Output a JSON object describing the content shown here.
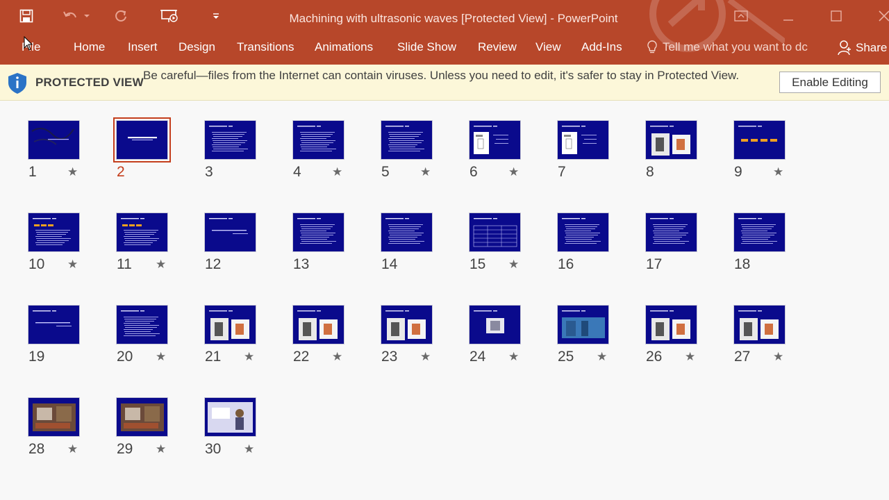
{
  "window": {
    "title": "Machining with ultrasonic waves [Protected View] - PowerPoint"
  },
  "qat": {
    "save_icon": "save-icon",
    "undo_icon": "undo-icon",
    "redo_icon": "redo-icon",
    "present_icon": "present-from-beginning-icon",
    "customize_icon": "customize-qat-icon"
  },
  "tabs": [
    {
      "label": "File"
    },
    {
      "label": "Home"
    },
    {
      "label": "Insert"
    },
    {
      "label": "Design"
    },
    {
      "label": "Transitions"
    },
    {
      "label": "Animations"
    },
    {
      "label": "Slide Show"
    },
    {
      "label": "Review"
    },
    {
      "label": "View"
    },
    {
      "label": "Add-Ins"
    }
  ],
  "tell_me": {
    "placeholder": "Tell me what you want to dc"
  },
  "share": {
    "label": "Share"
  },
  "protected_view": {
    "label": "PROTECTED VIEW",
    "message": "Be careful—files from the Internet can contain viruses. Unless you need to edit, it's safer to stay in Protected View.",
    "button": "Enable Editing"
  },
  "slides": [
    {
      "number": "1",
      "has_animation": true,
      "kind": "title-dark",
      "selected": false
    },
    {
      "number": "2",
      "has_animation": false,
      "kind": "title",
      "selected": true
    },
    {
      "number": "3",
      "has_animation": false,
      "kind": "text",
      "selected": false
    },
    {
      "number": "4",
      "has_animation": true,
      "kind": "text",
      "selected": false
    },
    {
      "number": "5",
      "has_animation": true,
      "kind": "text",
      "selected": false
    },
    {
      "number": "6",
      "has_animation": true,
      "kind": "diagram",
      "selected": false
    },
    {
      "number": "7",
      "has_animation": false,
      "kind": "diagram",
      "selected": false
    },
    {
      "number": "8",
      "has_animation": false,
      "kind": "photo",
      "selected": false
    },
    {
      "number": "9",
      "has_animation": true,
      "kind": "flow",
      "selected": false
    },
    {
      "number": "10",
      "has_animation": true,
      "kind": "flow-text",
      "selected": false
    },
    {
      "number": "11",
      "has_animation": true,
      "kind": "flow-text",
      "selected": false
    },
    {
      "number": "12",
      "has_animation": false,
      "kind": "sparse",
      "selected": false
    },
    {
      "number": "13",
      "has_animation": false,
      "kind": "text",
      "selected": false
    },
    {
      "number": "14",
      "has_animation": false,
      "kind": "text",
      "selected": false
    },
    {
      "number": "15",
      "has_animation": true,
      "kind": "table",
      "selected": false
    },
    {
      "number": "16",
      "has_animation": false,
      "kind": "text",
      "selected": false
    },
    {
      "number": "17",
      "has_animation": false,
      "kind": "text",
      "selected": false
    },
    {
      "number": "18",
      "has_animation": false,
      "kind": "text",
      "selected": false
    },
    {
      "number": "19",
      "has_animation": false,
      "kind": "sparse",
      "selected": false
    },
    {
      "number": "20",
      "has_animation": true,
      "kind": "text",
      "selected": false
    },
    {
      "number": "21",
      "has_animation": true,
      "kind": "photo",
      "selected": false
    },
    {
      "number": "22",
      "has_animation": true,
      "kind": "photo",
      "selected": false
    },
    {
      "number": "23",
      "has_animation": true,
      "kind": "photo",
      "selected": false
    },
    {
      "number": "24",
      "has_animation": true,
      "kind": "photo-small",
      "selected": false
    },
    {
      "number": "25",
      "has_animation": true,
      "kind": "photo-wide",
      "selected": false
    },
    {
      "number": "26",
      "has_animation": true,
      "kind": "photo",
      "selected": false
    },
    {
      "number": "27",
      "has_animation": true,
      "kind": "photo",
      "selected": false
    },
    {
      "number": "28",
      "has_animation": true,
      "kind": "photo-full",
      "selected": false
    },
    {
      "number": "29",
      "has_animation": true,
      "kind": "photo-full",
      "selected": false
    },
    {
      "number": "30",
      "has_animation": true,
      "kind": "photo-person",
      "selected": false
    }
  ],
  "colors": {
    "ribbon": "#b7472a",
    "slide_bg": "#0a0a8c",
    "selection": "#c43e1c",
    "protected_bg": "#fcf7d9"
  }
}
